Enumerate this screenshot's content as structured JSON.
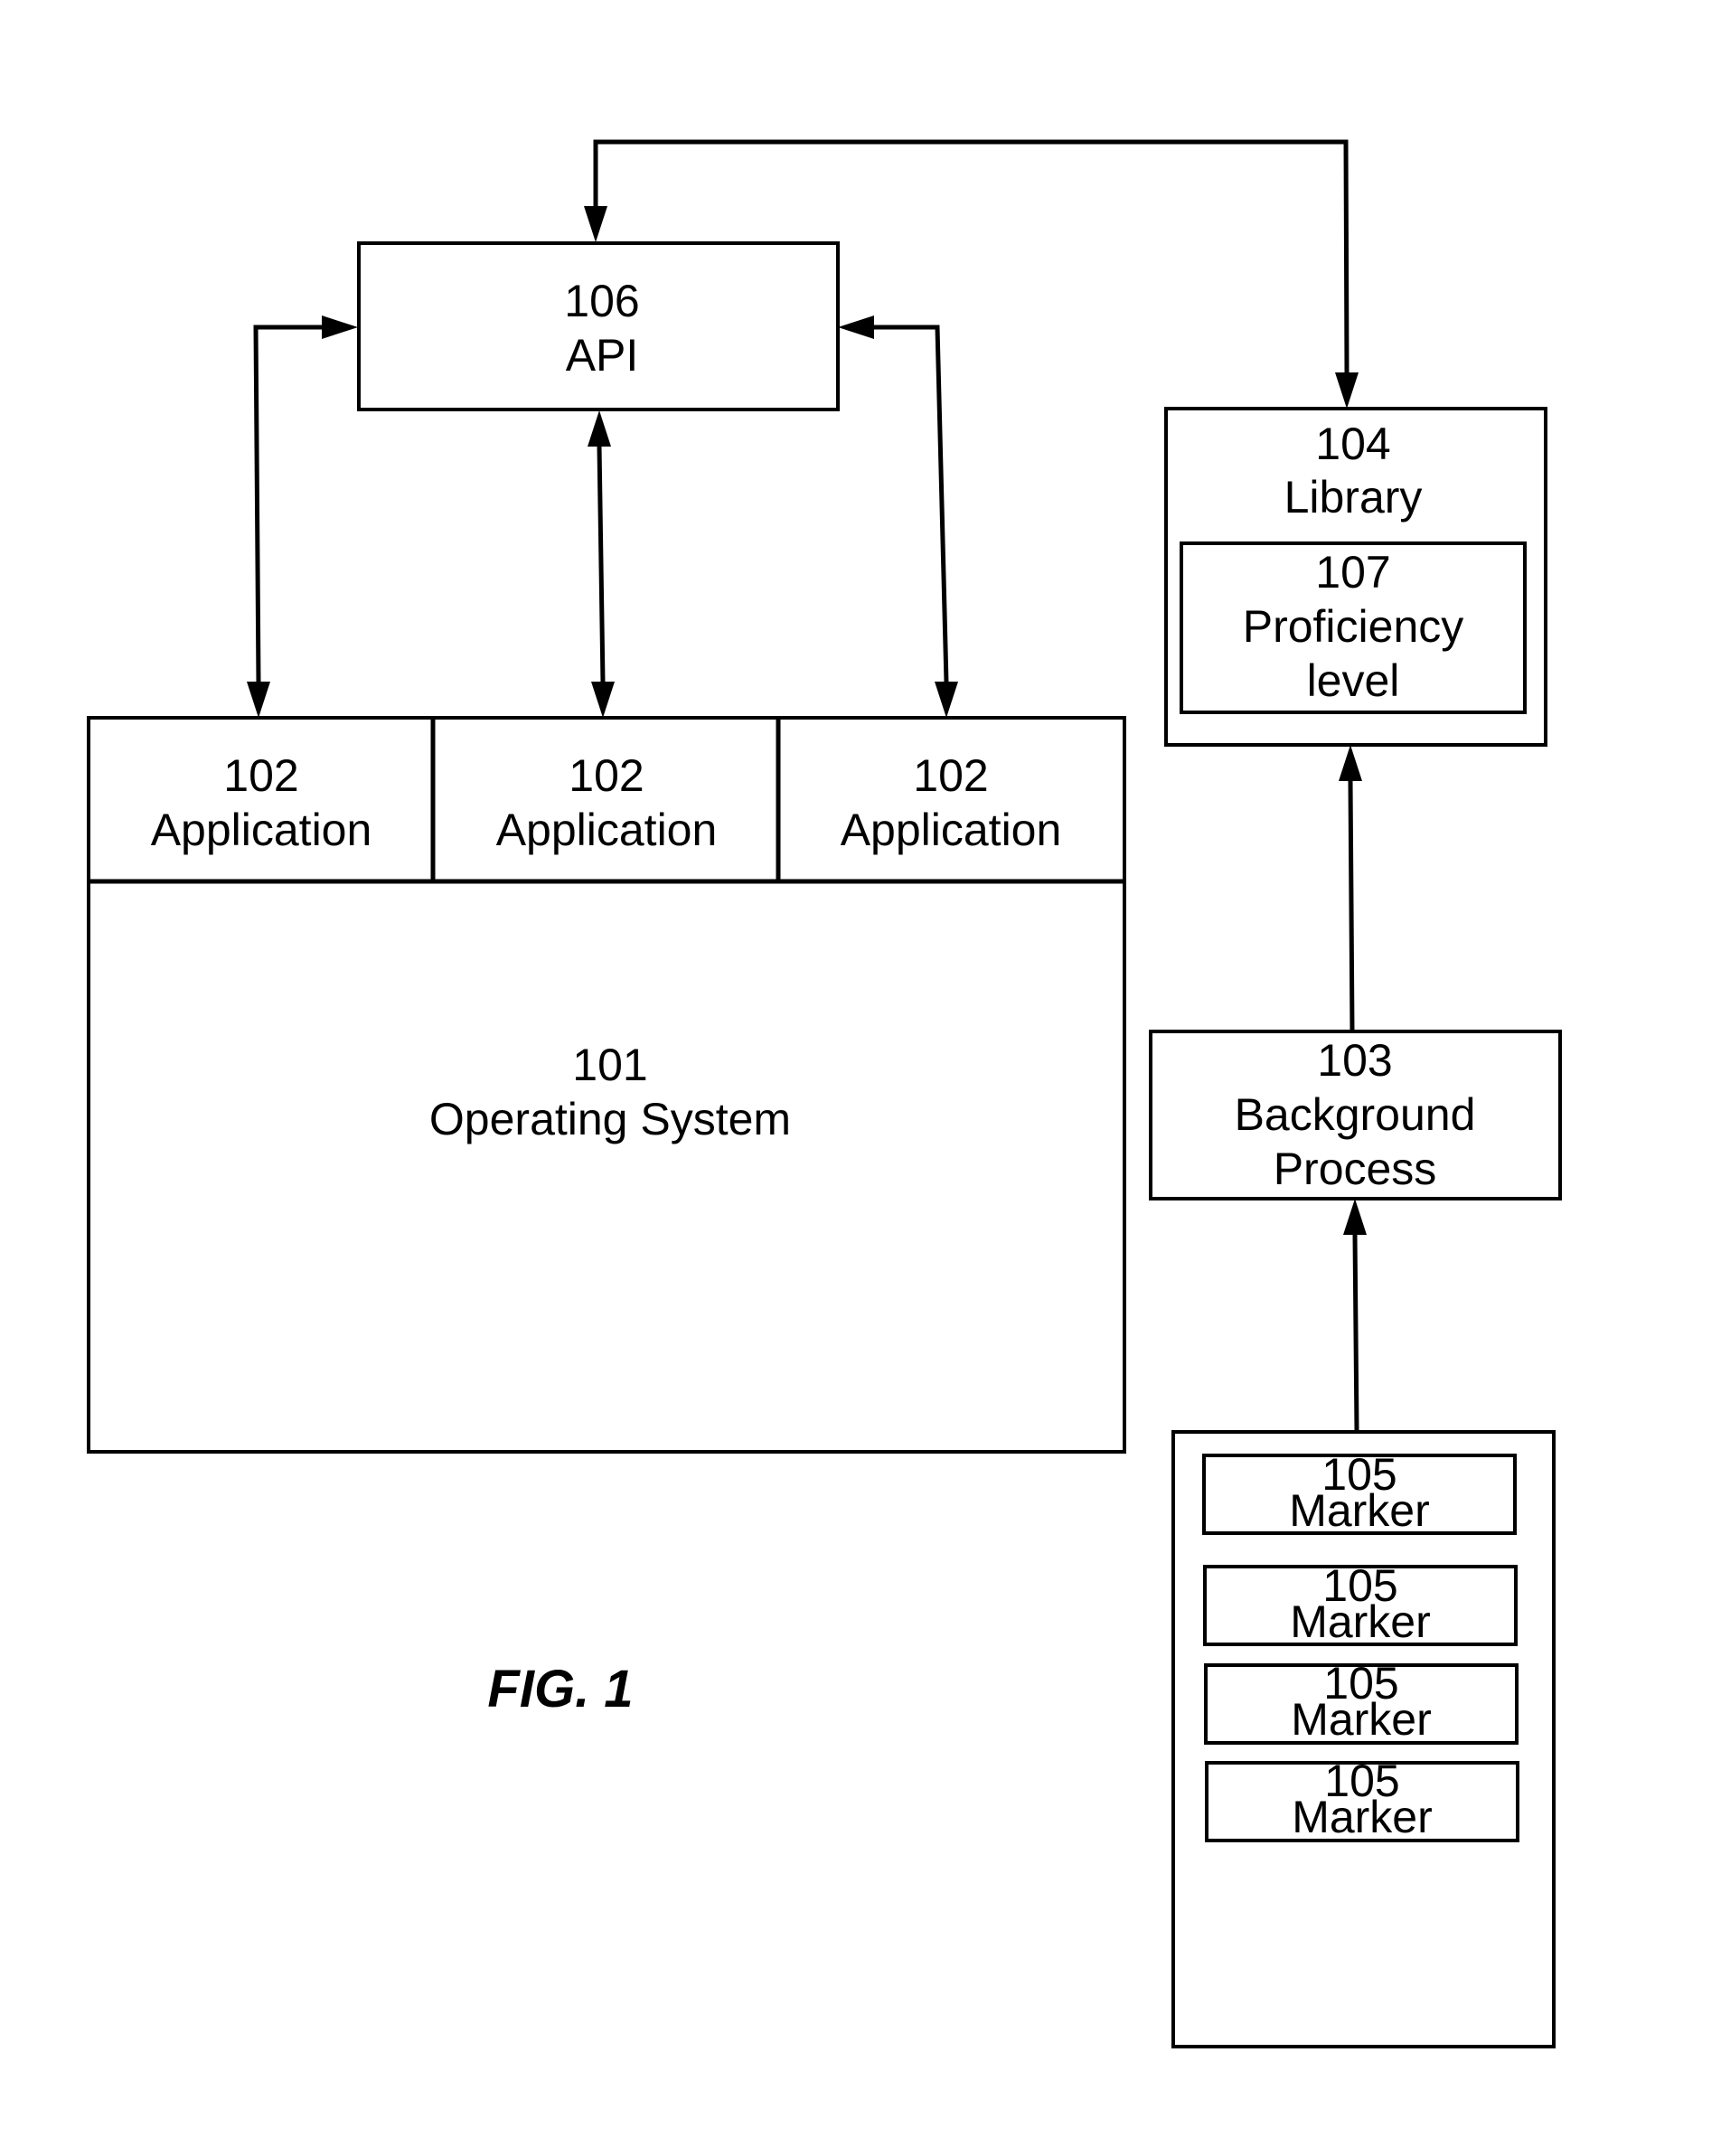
{
  "figure_label": "FIG. 1",
  "nodes": {
    "api": {
      "number": "106",
      "label": "API"
    },
    "library": {
      "number": "104",
      "label": "Library"
    },
    "proficiency": {
      "number": "107",
      "label_line1": "Proficiency",
      "label_line2": "level"
    },
    "applications": [
      {
        "number": "102",
        "label": "Application"
      },
      {
        "number": "102",
        "label": "Application"
      },
      {
        "number": "102",
        "label": "Application"
      }
    ],
    "operating_system": {
      "number": "101",
      "label": "Operating System"
    },
    "background_process": {
      "number": "103",
      "label_line1": "Background",
      "label_line2": "Process"
    },
    "markers": [
      {
        "number": "105",
        "label": "Marker"
      },
      {
        "number": "105",
        "label": "Marker"
      },
      {
        "number": "105",
        "label": "Marker"
      },
      {
        "number": "105",
        "label": "Marker"
      }
    ]
  },
  "connections": [
    {
      "from": "api",
      "to": "library",
      "direction": "bidirectional"
    },
    {
      "from": "api",
      "to": "application-1",
      "direction": "bidirectional"
    },
    {
      "from": "api",
      "to": "application-2",
      "direction": "bidirectional"
    },
    {
      "from": "api",
      "to": "application-3",
      "direction": "bidirectional"
    },
    {
      "from": "background-process",
      "to": "library",
      "direction": "forward"
    },
    {
      "from": "markers",
      "to": "background-process",
      "direction": "forward"
    }
  ]
}
